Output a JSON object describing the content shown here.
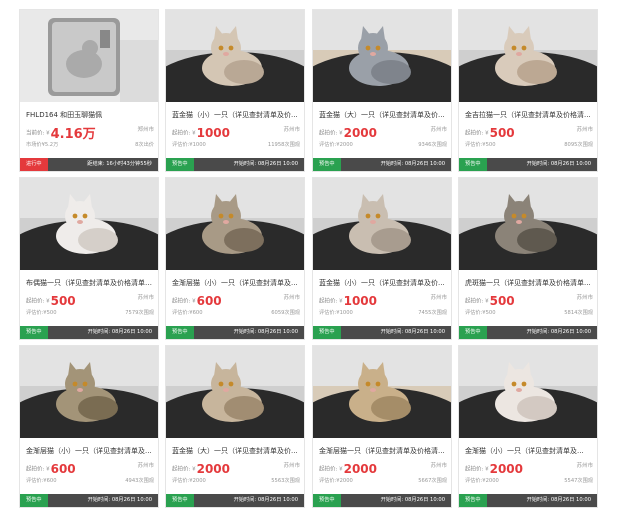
{
  "cards": [
    {
      "title": "FHLD164 和田玉聊猫佩",
      "price_label": "当前价: ¥",
      "price": "4.16万",
      "loc": "郑州市",
      "meta_left": "市场价¥5.2万",
      "views": "8次出价",
      "badge": "进行中",
      "status": "距结束: 16小时43分钟55秒",
      "photo": "jade"
    },
    {
      "title": "蓝金猫（小）一只（详见查封清单及价...",
      "price_label": "起拍价: ¥",
      "price": "1000",
      "loc": "苏州市",
      "meta_left": "评估价:¥1000",
      "views": "11958次围观",
      "badge": "预告中",
      "status": "开始时间: 08月26日 10:00",
      "photo": "cat1"
    },
    {
      "title": "蓝金猫（大）一只（详见查封清单及价...",
      "price_label": "起拍价: ¥",
      "price": "2000",
      "loc": "苏州市",
      "meta_left": "评估价:¥2000",
      "views": "9346次围观",
      "badge": "预告中",
      "status": "开始时间: 08月26日 10:00",
      "photo": "cat2"
    },
    {
      "title": "金吉拉猫一只（详见查封清单及价格清...",
      "price_label": "起拍价: ¥",
      "price": "500",
      "loc": "苏州市",
      "meta_left": "评估价:¥500",
      "views": "8095次围观",
      "badge": "预告中",
      "status": "开始时间: 08月26日 10:00",
      "photo": "cat3"
    },
    {
      "title": "布偶猫一只（详见查封清单及价格清单知...",
      "price_label": "起拍价: ¥",
      "price": "500",
      "loc": "苏州市",
      "meta_left": "评估价:¥500",
      "views": "7579次围观",
      "badge": "预告中",
      "status": "开始时间: 08月26日 10:00",
      "photo": "cat4"
    },
    {
      "title": "金渐层猫（小）一只（详见查封清单及...",
      "price_label": "起拍价: ¥",
      "price": "600",
      "loc": "苏州市",
      "meta_left": "评估价:¥600",
      "views": "6059次围观",
      "badge": "预告中",
      "status": "开始时间: 08月26日 10:00",
      "photo": "cat5"
    },
    {
      "title": "蓝金猫（小）一只（详见查封清单及价...",
      "price_label": "起拍价: ¥",
      "price": "1000",
      "loc": "苏州市",
      "meta_left": "评估价:¥1000",
      "views": "7455次围观",
      "badge": "预告中",
      "status": "开始时间: 08月26日 10:00",
      "photo": "cat6"
    },
    {
      "title": "虎斑猫一只（详见查封清单及价格清单...",
      "price_label": "起拍价: ¥",
      "price": "500",
      "loc": "苏州市",
      "meta_left": "评估价:¥500",
      "views": "5814次围观",
      "badge": "预告中",
      "status": "开始时间: 08月26日 10:00",
      "photo": "cat7"
    },
    {
      "title": "金渐层猫（小）一只（详见查封清单及...",
      "price_label": "起拍价: ¥",
      "price": "600",
      "loc": "苏州市",
      "meta_left": "评估价:¥600",
      "views": "4943次围观",
      "badge": "预告中",
      "status": "开始时间: 08月26日 10:00",
      "photo": "cat8"
    },
    {
      "title": "蓝金猫（大）一只（详见查封清单及价...",
      "price_label": "起拍价: ¥",
      "price": "2000",
      "loc": "苏州市",
      "meta_left": "评估价:¥2000",
      "views": "5563次围观",
      "badge": "预告中",
      "status": "开始时间: 08月26日 10:00",
      "photo": "cat9"
    },
    {
      "title": "金渐层猫一只（详见查封清单及价格清...",
      "price_label": "起拍价: ¥",
      "price": "2000",
      "loc": "苏州市",
      "meta_left": "评估价:¥2000",
      "views": "5667次围观",
      "badge": "预告中",
      "status": "开始时间: 08月26日 10:00",
      "photo": "cat10"
    },
    {
      "title": "金渐猫（小）一只（详见查封清单及...",
      "price_label": "起拍价: ¥",
      "price": "2000",
      "loc": "苏州市",
      "meta_left": "评估价:¥2000",
      "views": "5547次围观",
      "badge": "预告中",
      "status": "开始时间: 08月26日 10:00",
      "photo": "cat11"
    }
  ]
}
